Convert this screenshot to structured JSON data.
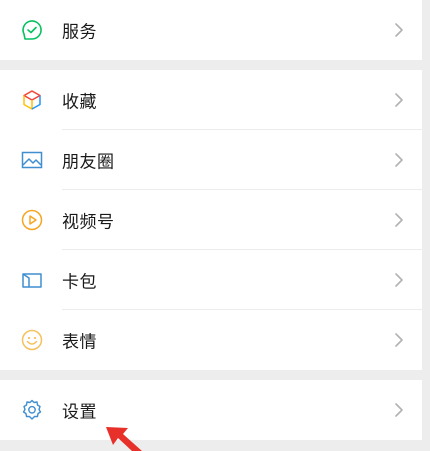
{
  "menu": {
    "service_label": "服务",
    "favorites_label": "收藏",
    "moments_label": "朋友圈",
    "channels_label": "视频号",
    "cards_label": "卡包",
    "stickers_label": "表情",
    "settings_label": "设置"
  },
  "icons": {
    "service": "wallet-check-icon",
    "favorites": "cube-icon",
    "moments": "image-icon",
    "channels": "play-circle-icon",
    "cards": "card-icon",
    "stickers": "smiley-icon",
    "settings": "gear-icon",
    "chevron": "chevron-right-icon",
    "cursor": "red-arrow-cursor"
  },
  "colors": {
    "page_background": "#ededed",
    "row_background": "#ffffff",
    "text": "#191919",
    "chevron": "#b2b2b2",
    "service_green": "#07c160",
    "favorites_multicolor": [
      "#f44336",
      "#2196f3",
      "#ffc107"
    ],
    "moments_blue": "#3e8ed0",
    "channels_orange": "#f5a623",
    "cards_blue": "#3e8ed0",
    "stickers_yellow": "#f5c15d",
    "settings_blue": "#3e8ed0",
    "cursor_red": "#e8302a"
  }
}
